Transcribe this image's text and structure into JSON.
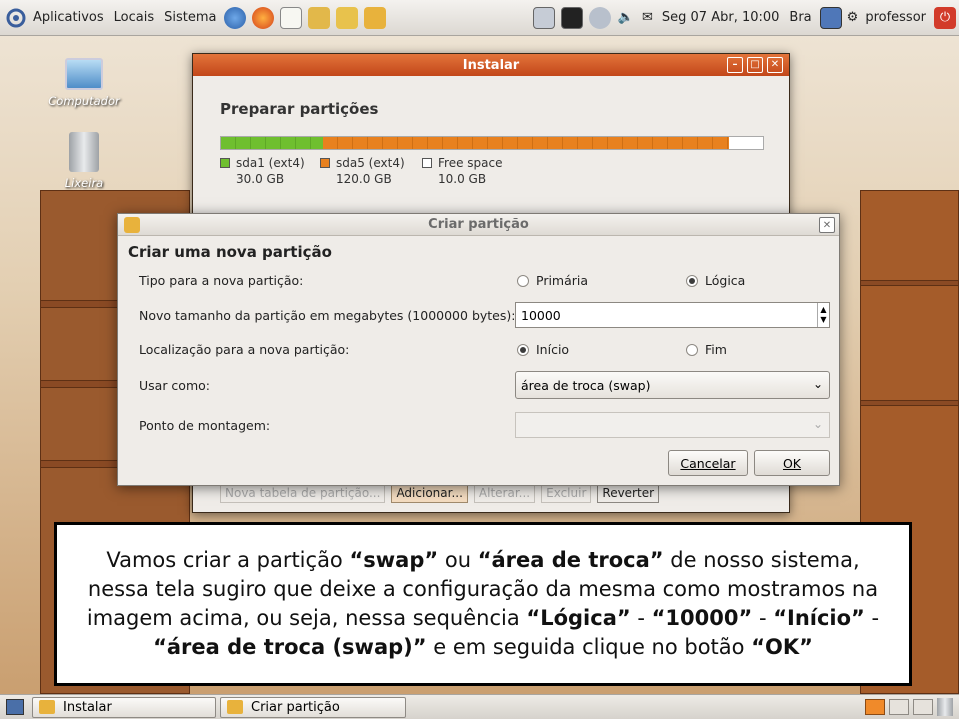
{
  "top_panel": {
    "menus": [
      "Aplicativos",
      "Locais",
      "Sistema"
    ],
    "clock": "Seg 07 Abr, 10:00",
    "keyboard": "Bra",
    "user": "professor"
  },
  "desktop": {
    "icons": [
      {
        "label": "Computador",
        "icon": "computer-icon"
      },
      {
        "label": "Lixeira",
        "icon": "trash-icon"
      }
    ]
  },
  "install_window": {
    "title": "Instalar",
    "heading": "Preparar partições",
    "bar_fractions": {
      "sda1": 0.1875,
      "sda5": 0.75,
      "free": 0.0625
    },
    "legend": [
      {
        "name": "sda1 (ext4)",
        "size": "30.0 GB",
        "color": "#6fbf2f"
      },
      {
        "name": "sda5 (ext4)",
        "size": "120.0 GB",
        "color": "#e8811f"
      },
      {
        "name": "Free space",
        "size": "10.0 GB",
        "color": "#ffffff"
      }
    ],
    "buttons": [
      "Nova tabela de partição...",
      "Adicionar...",
      "Alterar...",
      "Excluir",
      "Reverter"
    ]
  },
  "create_dialog": {
    "title": "Criar partição",
    "heading": "Criar uma nova partição",
    "type_label": "Tipo para a nova partição:",
    "type_options": [
      "Primária",
      "Lógica"
    ],
    "type_selected": "Lógica",
    "size_label": "Novo tamanho da partição em megabytes (1000000 bytes):",
    "size_value": "10000",
    "location_label": "Localização para a nova partição:",
    "location_options": [
      "Início",
      "Fim"
    ],
    "location_selected": "Início",
    "use_as_label": "Usar como:",
    "use_as_value": "área de troca (swap)",
    "mount_label": "Ponto de montagem:",
    "mount_value": "",
    "cancel": "Cancelar",
    "ok": "OK"
  },
  "caption": {
    "parts": [
      {
        "t": "Vamos criar a partição ",
        "b": false
      },
      {
        "t": "“swap”",
        "b": true
      },
      {
        "t": " ou ",
        "b": false
      },
      {
        "t": "“área de troca”",
        "b": true
      },
      {
        "t": " de nosso sistema, nessa tela sugiro que deixe a configuração da mesma como mostramos na imagem acima, ou seja, nessa sequência ",
        "b": false
      },
      {
        "t": "“Lógica”",
        "b": true
      },
      {
        "t": " - ",
        "b": false
      },
      {
        "t": "“10000”",
        "b": true
      },
      {
        "t": " - ",
        "b": false
      },
      {
        "t": "“Início”",
        "b": true
      },
      {
        "t": " - ",
        "b": false
      },
      {
        "t": "“área de troca (swap)”",
        "b": true
      },
      {
        "t": " e em seguida clique no botão ",
        "b": false
      },
      {
        "t": "“OK”",
        "b": true
      }
    ]
  },
  "bottom_panel": {
    "tasks": [
      "Instalar",
      "Criar partição"
    ]
  }
}
